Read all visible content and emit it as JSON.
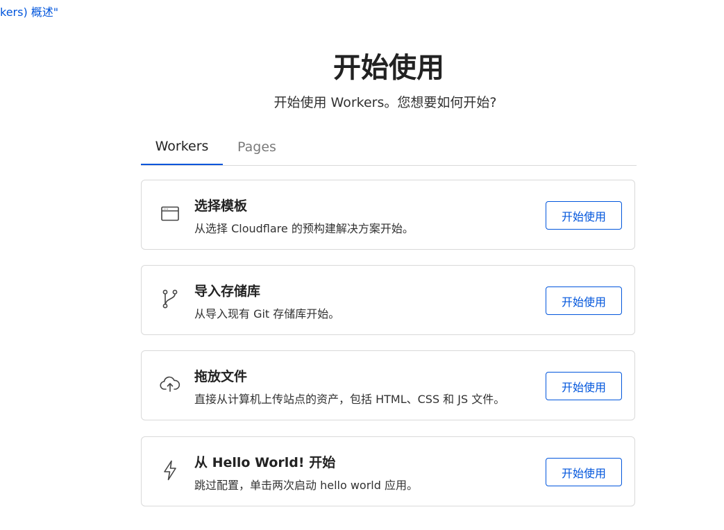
{
  "breadcrumb": {
    "link_text": "kers) 概述\""
  },
  "header": {
    "title": "开始使用",
    "subtitle": "开始使用 Workers。您想要如何开始?"
  },
  "tabs": [
    {
      "label": "Workers",
      "active": true
    },
    {
      "label": "Pages",
      "active": false
    }
  ],
  "options": [
    {
      "icon": "browser-window-icon",
      "title": "选择模板",
      "description": "从选择 Cloudflare 的预构建解决方案开始。",
      "button_label": "开始使用"
    },
    {
      "icon": "git-branch-icon",
      "title": "导入存储库",
      "description": "从导入现有 Git 存储库开始。",
      "button_label": "开始使用"
    },
    {
      "icon": "cloud-upload-icon",
      "title": "拖放文件",
      "description": "直接从计算机上传站点的资产，包括 HTML、CSS 和 JS 文件。",
      "button_label": "开始使用"
    },
    {
      "icon": "lightning-bolt-icon",
      "title": "从 Hello World! 开始",
      "description": "跳过配置，单击两次启动 hello world 应用。",
      "button_label": "开始使用"
    }
  ],
  "colors": {
    "accent": "#0055dc",
    "border": "#d9d9d9",
    "text": "#313131",
    "muted": "#7a7a7a"
  }
}
